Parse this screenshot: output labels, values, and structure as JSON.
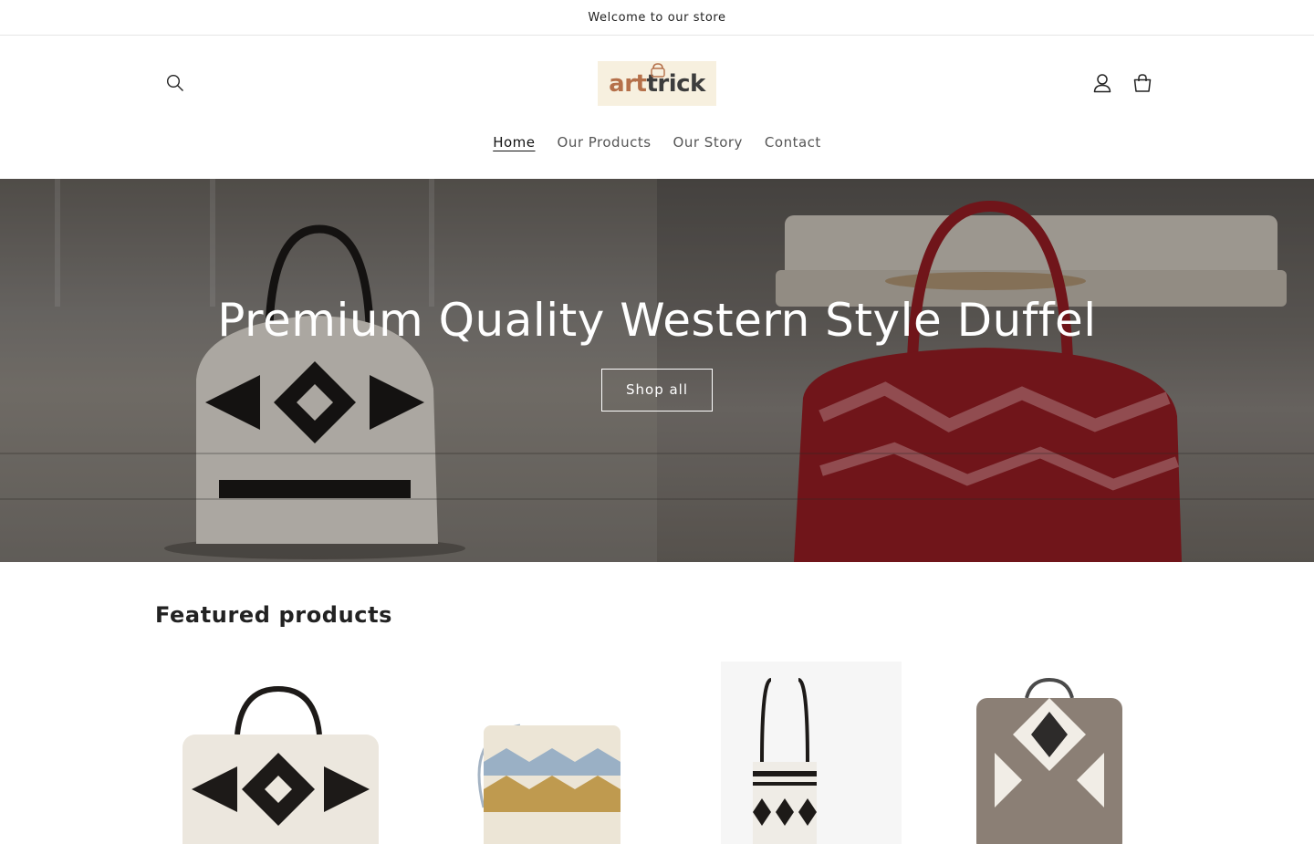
{
  "announcement": {
    "text": "Welcome to our store"
  },
  "header": {
    "logo_text_part1": "art",
    "logo_text_part2": "trick",
    "icons": [
      "search-icon",
      "account-icon",
      "cart-icon"
    ]
  },
  "nav": {
    "items": [
      {
        "label": "Home",
        "active": true
      },
      {
        "label": "Our Products",
        "active": false
      },
      {
        "label": "Our Story",
        "active": false
      },
      {
        "label": "Contact",
        "active": false
      }
    ]
  },
  "hero": {
    "title": "Premium Quality Western Style Duffel",
    "button_label": "Shop all"
  },
  "featured": {
    "title": "Featured products"
  },
  "colors": {
    "logo_bg": "#f7f0df",
    "logo_accent": "#b5704a",
    "bag_red": "#9b1e24",
    "bag_black": "#1d1a18"
  }
}
